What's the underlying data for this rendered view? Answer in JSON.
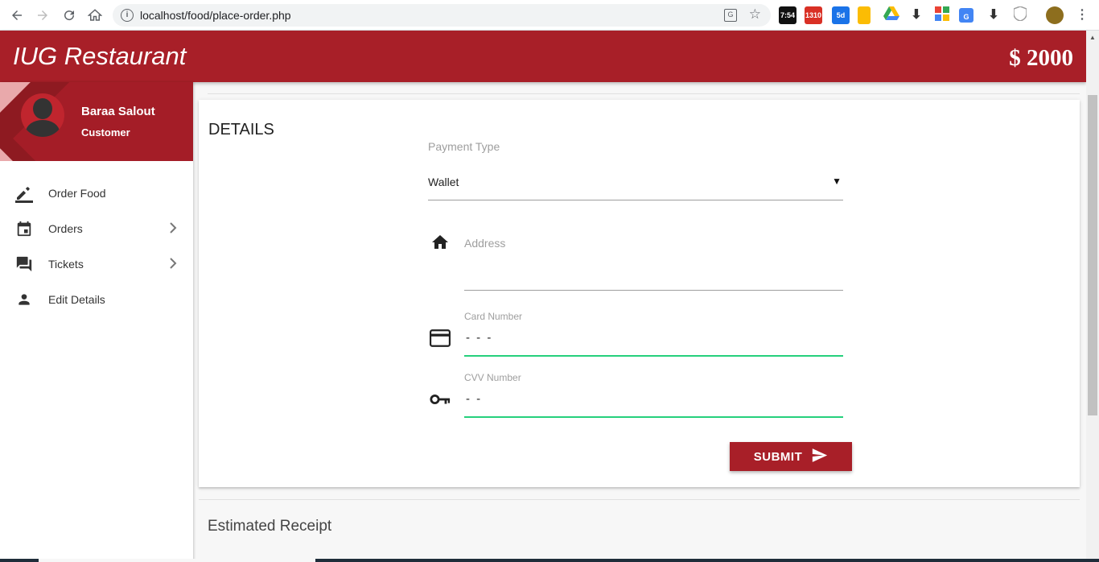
{
  "browser": {
    "url": "localhost/food/place-order.php",
    "extensions": [
      {
        "name": "clock-extension",
        "label": "7:54",
        "color": "#111111"
      },
      {
        "name": "gmail-extension",
        "label": "1310",
        "color": "#d93025"
      },
      {
        "name": "calendar-extension",
        "label": "5d",
        "color": "#1a73e8"
      },
      {
        "name": "keep-extension",
        "label": "",
        "color": "#fbbc04"
      },
      {
        "name": "drive-extension",
        "label": "",
        "color": "#34a853"
      },
      {
        "name": "download-extension",
        "label": "",
        "color": "#333333"
      },
      {
        "name": "colorpicker-extension",
        "label": "",
        "color": "#4285f4"
      },
      {
        "name": "translate-extension",
        "label": "",
        "color": "#4285f4"
      },
      {
        "name": "download2-extension",
        "label": "",
        "color": "#333333"
      },
      {
        "name": "shield-extension",
        "label": "",
        "color": "#9e9e9e"
      }
    ]
  },
  "header": {
    "title": "IUG Restaurant",
    "balance": "$ 2000"
  },
  "sidebar": {
    "user": {
      "name": "Baraa Salout",
      "role": "Customer"
    },
    "items": [
      {
        "label": "Order Food",
        "icon": "pencil-icon",
        "has_submenu": false
      },
      {
        "label": "Orders",
        "icon": "calendar-icon",
        "has_submenu": true
      },
      {
        "label": "Tickets",
        "icon": "forum-icon",
        "has_submenu": true
      },
      {
        "label": "Edit Details",
        "icon": "person-icon",
        "has_submenu": false
      }
    ]
  },
  "details": {
    "title": "DETAILS",
    "payment_type_label": "Payment Type",
    "payment_type_value": "Wallet",
    "address_label": "Address",
    "address_value": "",
    "card_number_label": "Card Number",
    "card_number_value": "- - -",
    "cvv_label": "CVV Number",
    "cvv_value": "- -",
    "submit_label": "SUBMIT"
  },
  "receipt": {
    "title": "Estimated Receipt"
  },
  "colors": {
    "brand": "#a81f28",
    "active_input": "#26d07c"
  }
}
